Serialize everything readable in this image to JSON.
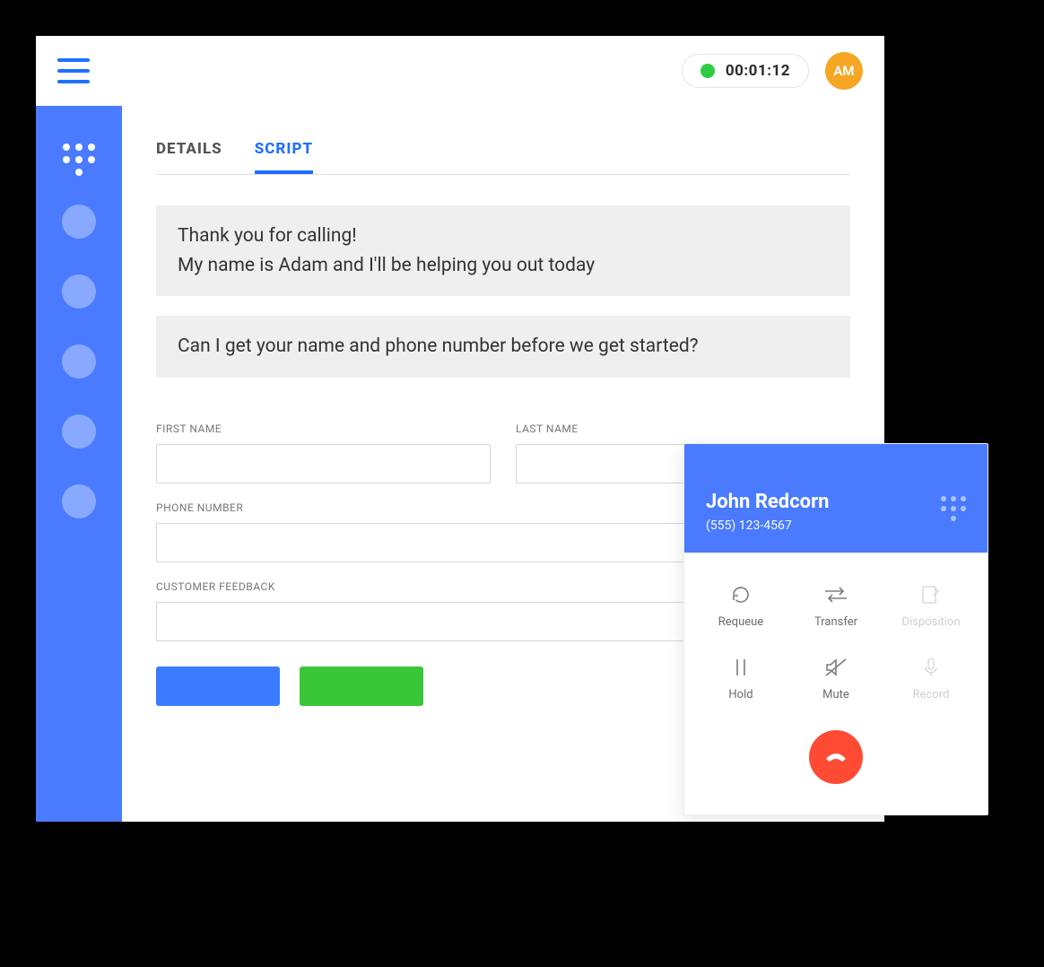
{
  "header": {
    "timer": "00:01:12",
    "avatar_initials": "AM",
    "status_color": "#2ecc40"
  },
  "tabs": {
    "details": "DETAILS",
    "script": "SCRIPT",
    "active": "script"
  },
  "script_blocks": [
    "Thank you for calling!\nMy name is Adam and I'll be helping you out today",
    "Can I get your name and phone number before we get started?"
  ],
  "form": {
    "first_name": {
      "label": "FIRST NAME",
      "value": ""
    },
    "last_name": {
      "label": "LAST NAME",
      "value": ""
    },
    "phone_number": {
      "label": "PHONE NUMBER",
      "value": ""
    },
    "customer_feedback": {
      "label": "CUSTOMER FEEDBACK",
      "value": ""
    }
  },
  "call_panel": {
    "caller_name": "John Redcorn",
    "caller_phone": "(555) 123-4567",
    "actions": {
      "requeue": "Requeue",
      "transfer": "Transfer",
      "disposition": "Disposition",
      "hold": "Hold",
      "mute": "Mute",
      "record": "Record"
    }
  },
  "colors": {
    "primary_blue": "#4a7bff",
    "accent_green": "#39c639",
    "hangup_red": "#ff4a34",
    "avatar_orange": "#f5a623"
  }
}
